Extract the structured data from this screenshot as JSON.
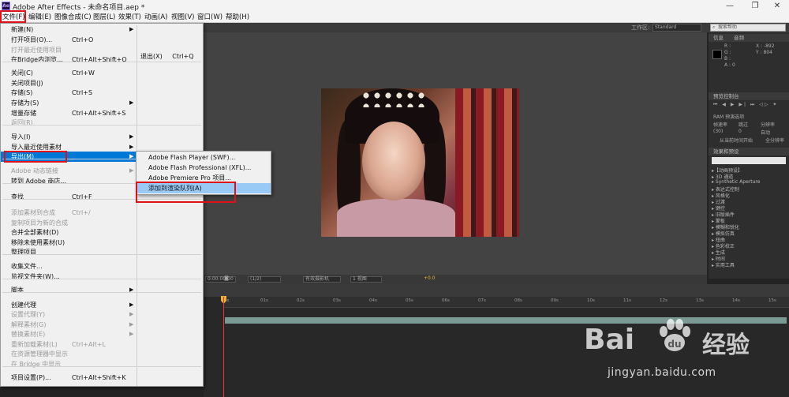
{
  "window": {
    "title": "Adobe After Effects - 未命名项目.aep *",
    "min": "—",
    "max": "❐",
    "close": "✕"
  },
  "menubar": [
    "文件(F)",
    "编辑(E)",
    "图像合成(C)",
    "图层(L)",
    "效果(T)",
    "动画(A)",
    "视图(V)",
    "窗口(W)",
    "帮助(H)"
  ],
  "toolbar": {
    "workspace_label": "工作区:",
    "workspace_value": "Standard",
    "search_placeholder": "搜索帮助"
  },
  "file_menu": [
    {
      "label": "新建(N)",
      "shortcut": "",
      "arrow": true,
      "enabled": true
    },
    {
      "label": "打开项目(O)...",
      "shortcut": "Ctrl+O",
      "enabled": true
    },
    {
      "label": "打开最近使用项目",
      "shortcut": "",
      "enabled": false
    },
    {
      "label": "在Bridge内浏览...",
      "shortcut": "Ctrl+Alt+Shift+O",
      "enabled": true
    },
    {
      "sep": true
    },
    {
      "label": "关闭(C)",
      "shortcut": "Ctrl+W",
      "enabled": true
    },
    {
      "label": "关闭项目(J)",
      "shortcut": "",
      "enabled": true
    },
    {
      "label": "存储(S)",
      "shortcut": "Ctrl+S",
      "enabled": true
    },
    {
      "label": "存储为(S)",
      "shortcut": "",
      "arrow": true,
      "enabled": true
    },
    {
      "label": "增量存储",
      "shortcut": "Ctrl+Alt+Shift+S",
      "enabled": true
    },
    {
      "label": "返回(R)",
      "shortcut": "",
      "enabled": false
    },
    {
      "sep": true
    },
    {
      "label": "导入(I)",
      "shortcut": "",
      "arrow": true,
      "enabled": true
    },
    {
      "label": "导入最近使用素材",
      "shortcut": "",
      "arrow": true,
      "enabled": true
    },
    {
      "label": "导出(M)",
      "shortcut": "",
      "arrow": true,
      "enabled": true,
      "highlight": true
    },
    {
      "sep": true
    },
    {
      "label": "Adobe 动态链接",
      "shortcut": "",
      "arrow": true,
      "enabled": false
    },
    {
      "label": "转到 Adobe 商店...",
      "shortcut": "",
      "enabled": true
    },
    {
      "sep": true
    },
    {
      "label": "查找",
      "shortcut": "Ctrl+F",
      "enabled": true
    },
    {
      "sep": true
    },
    {
      "label": "添加素材到合成",
      "shortcut": "Ctrl+/",
      "enabled": false
    },
    {
      "label": "复制项目为新的合成",
      "shortcut": "",
      "enabled": false
    },
    {
      "label": "合并全部素材(D)",
      "shortcut": "",
      "enabled": true
    },
    {
      "label": "移除未使用素材(U)",
      "shortcut": "",
      "enabled": true
    },
    {
      "label": "整理项目",
      "shortcut": "",
      "enabled": true
    },
    {
      "sep": true
    },
    {
      "label": "收集文件...",
      "shortcut": "",
      "enabled": true
    },
    {
      "label": "监视文件夹(W)...",
      "shortcut": "",
      "enabled": true
    },
    {
      "sep": true
    },
    {
      "label": "脚本",
      "shortcut": "",
      "arrow": true,
      "enabled": true
    },
    {
      "sep": true
    },
    {
      "label": "创建代理",
      "shortcut": "",
      "arrow": true,
      "enabled": true
    },
    {
      "label": "设置代理(Y)",
      "shortcut": "",
      "arrow": true,
      "enabled": false
    },
    {
      "label": "解释素材(G)",
      "shortcut": "",
      "arrow": true,
      "enabled": false
    },
    {
      "label": "替换素材(E)",
      "shortcut": "",
      "arrow": true,
      "enabled": false
    },
    {
      "label": "重新加载素材(L)",
      "shortcut": "Ctrl+Alt+L",
      "enabled": false
    },
    {
      "label": "在资源管理器中显示",
      "shortcut": "",
      "enabled": false
    },
    {
      "label": "在 Bridge 中显示",
      "shortcut": "",
      "enabled": false
    },
    {
      "sep": true
    },
    {
      "label": "项目设置(P)...",
      "shortcut": "Ctrl+Alt+Shift+K",
      "enabled": true
    }
  ],
  "exit_item": {
    "label": "退出(X)",
    "shortcut": "Ctrl+Q"
  },
  "export_submenu": [
    {
      "label": "Adobe Flash Player (SWF)..."
    },
    {
      "label": "Adobe Flash Professional (XFL)..."
    },
    {
      "label": "Adobe Premiere Pro 项目..."
    },
    {
      "label": "添加到渲染队列(A)",
      "highlight": true
    }
  ],
  "info_panel": {
    "tabs": [
      "信息",
      "音频"
    ],
    "r": "R :",
    "g": "G :",
    "b": "B :",
    "a": "A : 0",
    "x": "X : -892",
    "y": "Y : 804"
  },
  "preview_panel": {
    "tab": "预览控制台",
    "ram": "RAM 预演选项",
    "labels": [
      "帧速率",
      "跳过",
      "分辨率"
    ],
    "values": [
      "(30)",
      "0",
      "自动"
    ],
    "from_current": "从当前时间开始",
    "full_screen": "全分辨率"
  },
  "effects_panel": {
    "tab": "效果和预设",
    "items": [
      "▸【动画预设】",
      "▸ 3D 通道",
      "▸ Synthetic Aperture",
      "▸ 表达式控制",
      "▸ 风格化",
      "▸ 过渡",
      "▸ 键控",
      "▸ 旧版插件",
      "▸ 蒙板",
      "▸ 模糊和锐化",
      "▸ 模拟仿真",
      "▸ 扭曲",
      "▸ 色彩校正",
      "▸ 生成",
      "▸ 时间",
      "▸ 实用工具"
    ]
  },
  "comp_controls": {
    "time": "0:00:00:00",
    "zoom": "(1/2)",
    "camera": "有效摄影机",
    "views": "1 视图",
    "exposure": "+0.0"
  },
  "timeline": {
    "ticks": [
      "0s",
      "01s",
      "02s",
      "03s",
      "04s",
      "05s",
      "06s",
      "07s",
      "08s",
      "09s",
      "10s",
      "11s",
      "12s",
      "13s",
      "14s",
      "15s"
    ]
  },
  "watermark": {
    "brand": "Bai",
    "brand2": "经验",
    "url": "jingyan.baidu.com"
  }
}
